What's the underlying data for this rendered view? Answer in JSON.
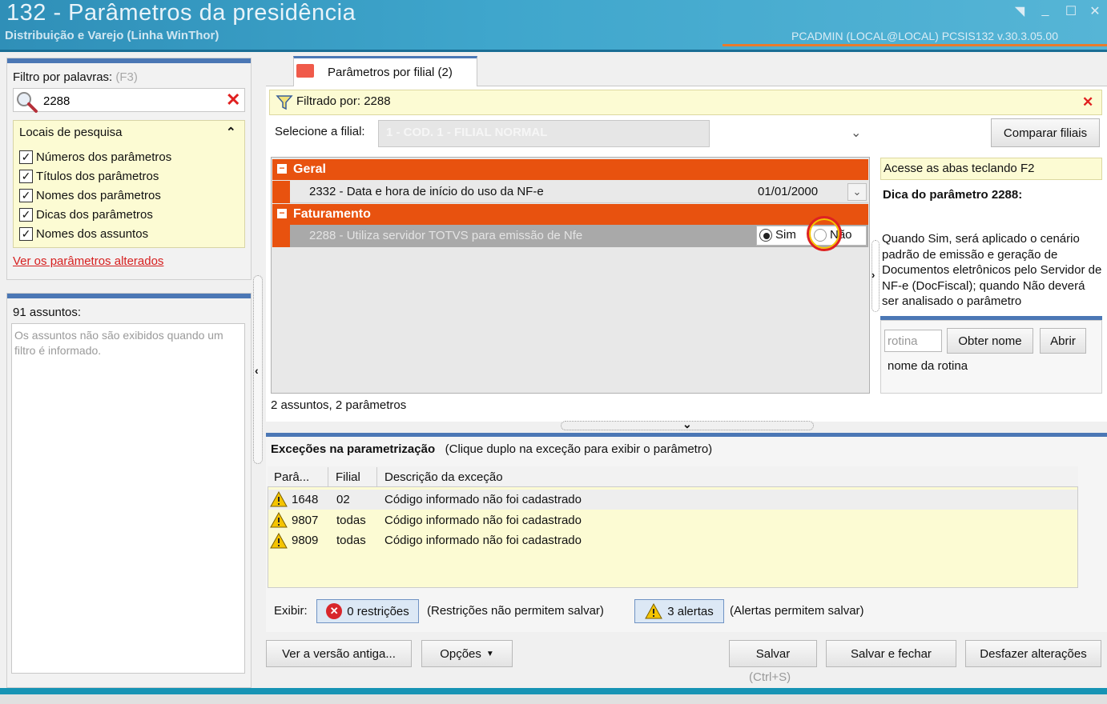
{
  "window": {
    "title": "132 - Parâmetros da presidência",
    "subtitle": "Distribuição e Varejo (Linha WinThor)",
    "user_info": "PCADMIN (LOCAL@LOCAL)   PCSIS132  v.30.3.05.00"
  },
  "left": {
    "filter_label": "Filtro por palavras:",
    "filter_hint": "(F3)",
    "search_value": "2288",
    "locais_title": "Locais de pesquisa",
    "checkboxes": [
      {
        "label": "Números dos parâmetros",
        "checked": true
      },
      {
        "label": "Títulos dos parâmetros",
        "checked": true
      },
      {
        "label": "Nomes dos parâmetros",
        "checked": true
      },
      {
        "label": "Dicas dos parâmetros",
        "checked": true
      },
      {
        "label": "Nomes dos assuntos",
        "checked": true
      }
    ],
    "changed_link": "Ver os parâmetros alterados",
    "assuntos_count": "91 assuntos:",
    "assuntos_msg": "Os assuntos não são exibidos quando um filtro é informado."
  },
  "tab": {
    "label": "Parâmetros por filial  (2)"
  },
  "filter_bar": {
    "text": "Filtrado por: 2288"
  },
  "filial": {
    "label": "Selecione a filial:",
    "value": "1 - COD. 1 - FILIAL NORMAL",
    "compare_button": "Comparar filiais"
  },
  "groups": [
    {
      "label": "Geral"
    },
    {
      "label": "Faturamento"
    }
  ],
  "params": [
    {
      "label": "2332 - Data e hora de início do uso da NF-e",
      "value": "01/01/2000"
    },
    {
      "label": "2288 - Utiliza servidor TOTVS para emissão de Nfe",
      "option_yes": "Sim",
      "option_no": "Não",
      "selected": "Sim"
    }
  ],
  "count_label": "2 assuntos, 2 parâmetros",
  "tip": {
    "bar": "Acesse as abas teclando F2",
    "title": "Dica do parâmetro 2288:",
    "body": "Quando Sim, será aplicado o cenário padrão de emissão e geração de Documentos eletrônicos pelo Servidor de NF-e (DocFiscal); quando Não deverá ser analisado o parâmetro"
  },
  "rotina": {
    "placeholder": "rotina",
    "get_name_button": "Obter nome",
    "open_button": "Abrir",
    "name_label": "nome da rotina"
  },
  "exceptions": {
    "title": "Exceções na parametrização",
    "subtitle": "(Clique duplo na exceção para exibir o parâmetro)",
    "columns": [
      "Parâ...",
      "Filial",
      "Descrição da exceção"
    ],
    "rows": [
      {
        "param": "1648",
        "filial": "02",
        "desc": "Código informado não foi cadastrado"
      },
      {
        "param": "9807",
        "filial": "todas",
        "desc": "Código informado não foi cadastrado"
      },
      {
        "param": "9809",
        "filial": "todas",
        "desc": "Código informado não foi cadastrado"
      }
    ],
    "show_label": "Exibir:",
    "restrictions_button": "0 restrições",
    "restrictions_desc": "(Restrições não permitem salvar)",
    "alerts_button": "3 alertas",
    "alerts_desc": "(Alertas permitem salvar)"
  },
  "footer": {
    "old_version": "Ver a versão antiga...",
    "options": "Opções",
    "save": "Salvar",
    "save_hint": "(Ctrl+S)",
    "save_close": "Salvar e fechar",
    "undo": "Desfazer alterações"
  },
  "colors": {
    "accent_blue": "#4b77b5",
    "group_orange": "#e8520f",
    "highlight_yellow": "#fcfbd3",
    "error_red": "#e02020"
  }
}
